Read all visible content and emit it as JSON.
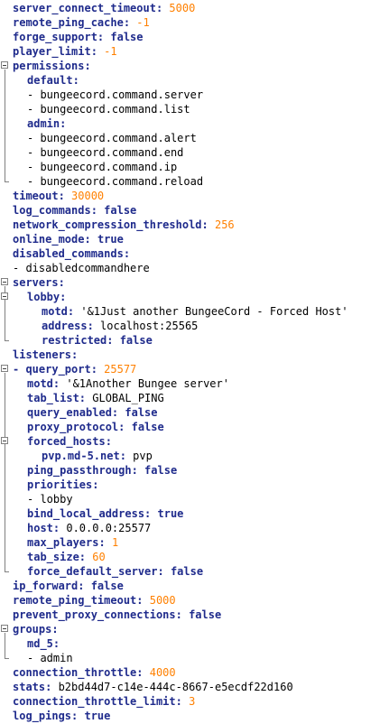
{
  "lines": [
    {
      "key": "server_connect_timeout",
      "sep": ": ",
      "value": "5000",
      "vtype": "num",
      "indent": 0
    },
    {
      "key": "remote_ping_cache",
      "sep": ": ",
      "value": "-1",
      "vtype": "num",
      "indent": 0
    },
    {
      "key": "forge_support",
      "sep": ": ",
      "value": "false",
      "vtype": "bool",
      "indent": 0
    },
    {
      "key": "player_limit",
      "sep": ": ",
      "value": "-1",
      "vtype": "num",
      "indent": 0
    },
    {
      "key": "permissions",
      "sep": ":",
      "value": "",
      "vtype": "none",
      "indent": 0,
      "fold": true
    },
    {
      "key": "default",
      "sep": ":",
      "value": "",
      "vtype": "none",
      "indent": 1
    },
    {
      "key": "",
      "sep": "",
      "value": "- bungeecord.command.server",
      "vtype": "str",
      "indent": 1
    },
    {
      "key": "",
      "sep": "",
      "value": "- bungeecord.command.list",
      "vtype": "str",
      "indent": 1
    },
    {
      "key": "admin",
      "sep": ":",
      "value": "",
      "vtype": "none",
      "indent": 1
    },
    {
      "key": "",
      "sep": "",
      "value": "- bungeecord.command.alert",
      "vtype": "str",
      "indent": 1
    },
    {
      "key": "",
      "sep": "",
      "value": "- bungeecord.command.end",
      "vtype": "str",
      "indent": 1
    },
    {
      "key": "",
      "sep": "",
      "value": "- bungeecord.command.ip",
      "vtype": "str",
      "indent": 1
    },
    {
      "key": "",
      "sep": "",
      "value": "- bungeecord.command.reload",
      "vtype": "str",
      "indent": 1
    },
    {
      "key": "timeout",
      "sep": ": ",
      "value": "30000",
      "vtype": "num",
      "indent": 0
    },
    {
      "key": "log_commands",
      "sep": ": ",
      "value": "false",
      "vtype": "bool",
      "indent": 0
    },
    {
      "key": "network_compression_threshold",
      "sep": ": ",
      "value": "256",
      "vtype": "num",
      "indent": 0
    },
    {
      "key": "online_mode",
      "sep": ": ",
      "value": "true",
      "vtype": "bool",
      "indent": 0
    },
    {
      "key": "disabled_commands",
      "sep": ":",
      "value": "",
      "vtype": "none",
      "indent": 0
    },
    {
      "key": "",
      "sep": "",
      "value": "- disabledcommandhere",
      "vtype": "str",
      "indent": 0
    },
    {
      "key": "servers",
      "sep": ":",
      "value": "",
      "vtype": "none",
      "indent": 0,
      "fold": true
    },
    {
      "key": "lobby",
      "sep": ":",
      "value": "",
      "vtype": "none",
      "indent": 1,
      "fold": true
    },
    {
      "key": "motd",
      "sep": ": ",
      "value": "'&1Just another BungeeCord - Forced Host'",
      "vtype": "str",
      "indent": 2
    },
    {
      "key": "address",
      "sep": ": ",
      "value": "localhost:25565",
      "vtype": "str",
      "indent": 2
    },
    {
      "key": "restricted",
      "sep": ": ",
      "value": "false",
      "vtype": "bool",
      "indent": 2
    },
    {
      "key": "listeners",
      "sep": ":",
      "value": "",
      "vtype": "none",
      "indent": 0
    },
    {
      "key": "- query_port",
      "sep": ": ",
      "value": "25577",
      "vtype": "num",
      "indent": 0,
      "fold": true
    },
    {
      "key": "motd",
      "sep": ": ",
      "value": "'&1Another Bungee server'",
      "vtype": "str",
      "indent": 1
    },
    {
      "key": "tab_list",
      "sep": ": ",
      "value": "GLOBAL_PING",
      "vtype": "str",
      "indent": 1
    },
    {
      "key": "query_enabled",
      "sep": ": ",
      "value": "false",
      "vtype": "bool",
      "indent": 1
    },
    {
      "key": "proxy_protocol",
      "sep": ": ",
      "value": "false",
      "vtype": "bool",
      "indent": 1
    },
    {
      "key": "forced_hosts",
      "sep": ":",
      "value": "",
      "vtype": "none",
      "indent": 1,
      "fold": true
    },
    {
      "key": "pvp.md-5.net",
      "sep": ": ",
      "value": "pvp",
      "vtype": "str",
      "indent": 2
    },
    {
      "key": "ping_passthrough",
      "sep": ": ",
      "value": "false",
      "vtype": "bool",
      "indent": 1
    },
    {
      "key": "priorities",
      "sep": ":",
      "value": "",
      "vtype": "none",
      "indent": 1
    },
    {
      "key": "",
      "sep": "",
      "value": "- lobby",
      "vtype": "str",
      "indent": 1
    },
    {
      "key": "bind_local_address",
      "sep": ": ",
      "value": "true",
      "vtype": "bool",
      "indent": 1
    },
    {
      "key": "host",
      "sep": ": ",
      "value": "0.0.0.0:25577",
      "vtype": "str",
      "indent": 1
    },
    {
      "key": "max_players",
      "sep": ": ",
      "value": "1",
      "vtype": "num",
      "indent": 1
    },
    {
      "key": "tab_size",
      "sep": ": ",
      "value": "60",
      "vtype": "num",
      "indent": 1
    },
    {
      "key": "force_default_server",
      "sep": ": ",
      "value": "false",
      "vtype": "bool",
      "indent": 1
    },
    {
      "key": "ip_forward",
      "sep": ": ",
      "value": "false",
      "vtype": "bool",
      "indent": 0
    },
    {
      "key": "remote_ping_timeout",
      "sep": ": ",
      "value": "5000",
      "vtype": "num",
      "indent": 0
    },
    {
      "key": "prevent_proxy_connections",
      "sep": ": ",
      "value": "false",
      "vtype": "bool",
      "indent": 0
    },
    {
      "key": "groups",
      "sep": ":",
      "value": "",
      "vtype": "none",
      "indent": 0,
      "fold": true
    },
    {
      "key": "md_5",
      "sep": ":",
      "value": "",
      "vtype": "none",
      "indent": 1
    },
    {
      "key": "",
      "sep": "",
      "value": "- admin",
      "vtype": "str",
      "indent": 1
    },
    {
      "key": "connection_throttle",
      "sep": ": ",
      "value": "4000",
      "vtype": "num",
      "indent": 0
    },
    {
      "key": "stats",
      "sep": ": ",
      "value": "b2bd44d7-c14e-444c-8667-e5ecdf22d160",
      "vtype": "str",
      "indent": 0
    },
    {
      "key": "connection_throttle_limit",
      "sep": ": ",
      "value": "3",
      "vtype": "num",
      "indent": 0
    },
    {
      "key": "log_pings",
      "sep": ": ",
      "value": "true",
      "vtype": "bool",
      "indent": 0
    }
  ],
  "colors": {
    "key": "#1f2b8c",
    "number": "#ff8000",
    "string": "#000000",
    "fold_box": "#808080"
  }
}
